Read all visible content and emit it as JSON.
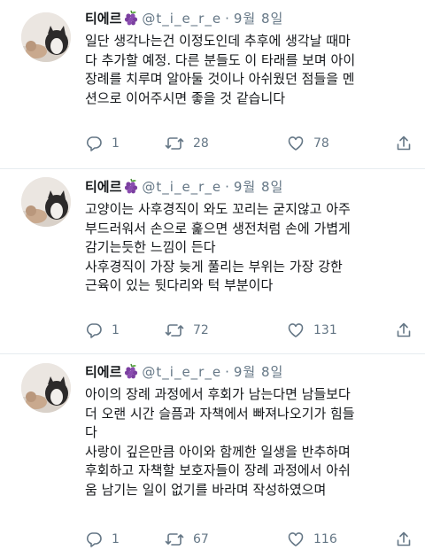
{
  "tweets": [
    {
      "name": "티에르",
      "handle": "@t_i_e_r_e",
      "separator": "·",
      "date": "9월 8일",
      "lines": [
        "일단 생각나는건 이정도인데 추후에 생각날 때마",
        "다 추가할 예정. 다른 분들도 이 타래를 보며 아이",
        "장례를 치루며 알아둘 것이나 아쉬웠던 점들을 멘",
        "션으로 이어주시면 좋을 것 같습니다"
      ],
      "replies": "1",
      "retweets": "28",
      "likes": "78"
    },
    {
      "name": "티에르",
      "handle": "@t_i_e_r_e",
      "separator": "·",
      "date": "9월 8일",
      "lines": [
        "고양이는 사후경직이 와도 꼬리는 굳지않고 아주",
        "부드러워서 손으로 훑으면 생전처럼 손에 가볍게",
        "감기는듯한 느낌이 든다",
        "사후경직이 가장 늦게 풀리는 부위는 가장 강한",
        "근육이 있는 뒷다리와 턱 부분이다"
      ],
      "replies": "1",
      "retweets": "72",
      "likes": "131"
    },
    {
      "name": "티에르",
      "handle": "@t_i_e_r_e",
      "separator": "·",
      "date": "9월 8일",
      "lines": [
        "아이의 장례 과정에서 후회가 남는다면 남들보다",
        "더 오랜 시간 슬픔과 자책에서 빠져나오기가 힘들",
        "다",
        "사랑이 깊은만큼 아이와 함께한 일생을 반추하며",
        "후회하고 자책할 보호자들이 장례 과정에서 아쉬",
        "움 남기는 일이 없기를 바라며 작성하였으며"
      ],
      "replies": "1",
      "retweets": "67",
      "likes": "116"
    }
  ],
  "colors": {
    "text": "#14171a",
    "muted": "#657786",
    "divider": "#e6ecf0",
    "grape": "#7b3fa0"
  },
  "icons": [
    "avatar-cat-photo",
    "grape-emoji",
    "reply-icon",
    "retweet-icon",
    "like-icon",
    "share-icon"
  ]
}
